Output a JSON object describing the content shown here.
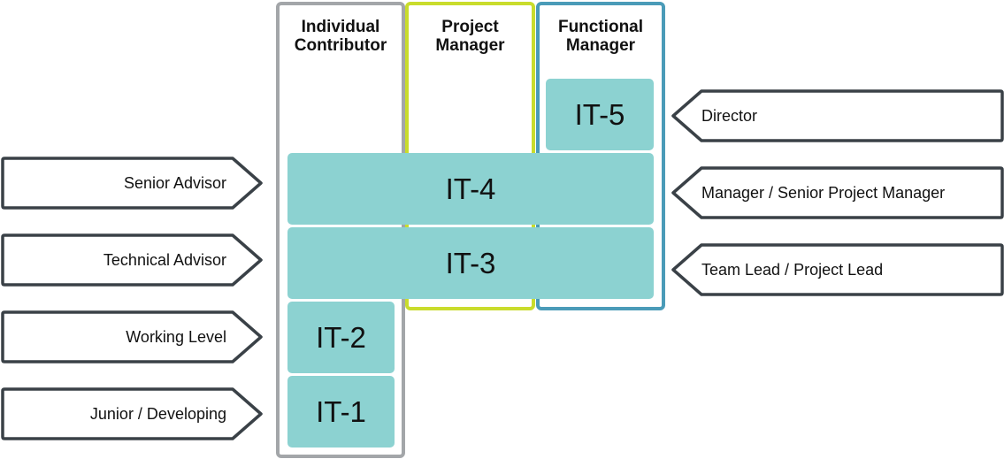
{
  "tracks": [
    {
      "id": "ic",
      "title_line1": "Individual",
      "title_line2": "Contributor",
      "color": "#a3a6a9"
    },
    {
      "id": "pm",
      "title_line1": "Project",
      "title_line2": "Manager",
      "color": "#c9dc2c"
    },
    {
      "id": "fm",
      "title_line1": "Functional",
      "title_line2": "Manager",
      "color": "#4a9bb8"
    }
  ],
  "levels": [
    {
      "label": "IT-5",
      "tracks": [
        "fm"
      ]
    },
    {
      "label": "IT-4",
      "tracks": [
        "ic",
        "pm",
        "fm"
      ]
    },
    {
      "label": "IT-3",
      "tracks": [
        "ic",
        "pm",
        "fm"
      ]
    },
    {
      "label": "IT-2",
      "tracks": [
        "ic"
      ]
    },
    {
      "label": "IT-1",
      "tracks": [
        "ic"
      ]
    }
  ],
  "left_tags": [
    {
      "label": "Senior Advisor",
      "level": "IT-4"
    },
    {
      "label": "Technical Advisor",
      "level": "IT-3"
    },
    {
      "label": "Working Level",
      "level": "IT-2"
    },
    {
      "label": "Junior / Developing",
      "level": "IT-1"
    }
  ],
  "right_tags": [
    {
      "label": "Director",
      "level": "IT-5"
    },
    {
      "label": "Manager / Senior Project Manager",
      "level": "IT-4"
    },
    {
      "label": "Team Lead / Project Lead",
      "level": "IT-3"
    }
  ],
  "colors": {
    "level_fill": "#8cd2d1",
    "tag_stroke": "#3a4147"
  }
}
